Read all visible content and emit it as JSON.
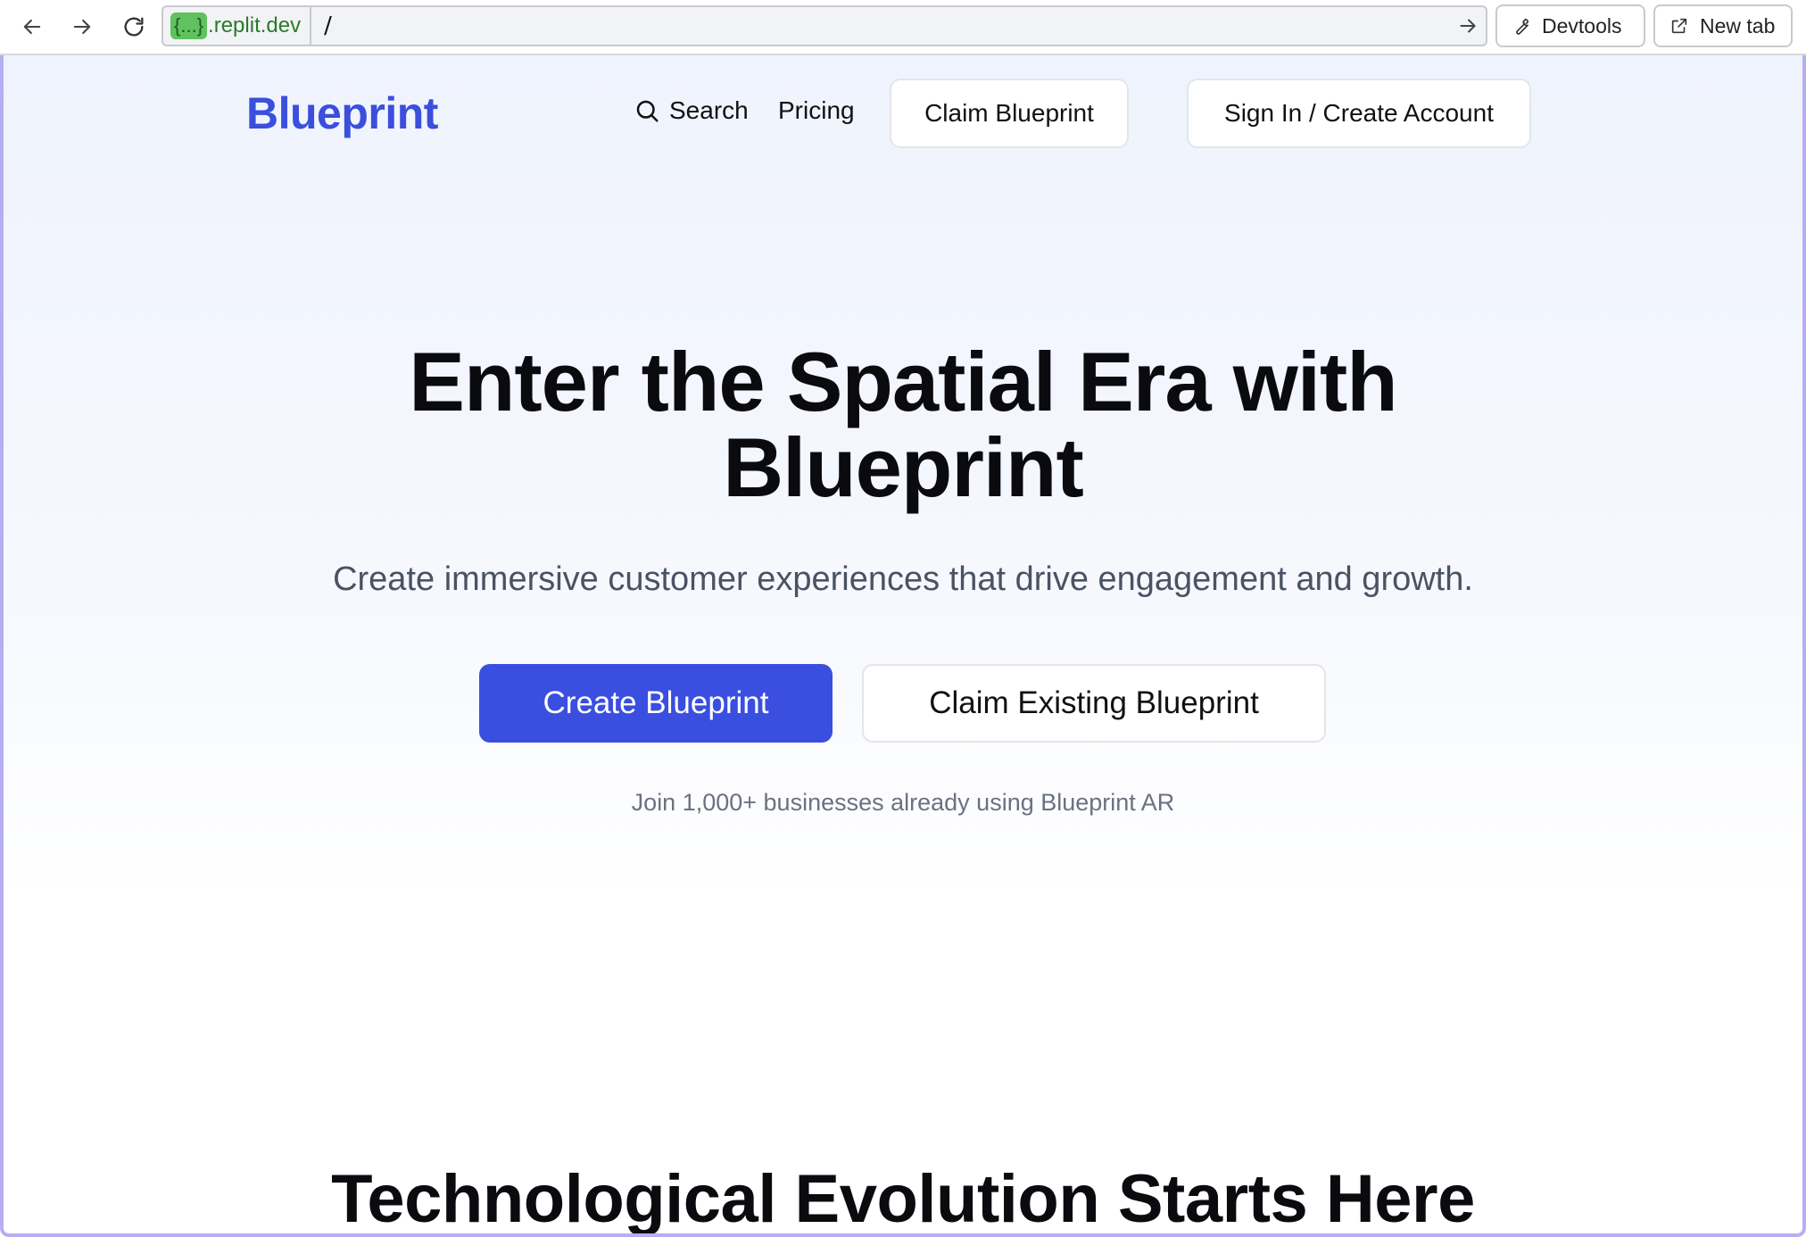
{
  "browser": {
    "url_host_pill": "{...}",
    "url_host": ".replit.dev",
    "url_path": "/",
    "devtools_label": "Devtools",
    "new_tab_label": "New tab"
  },
  "header": {
    "logo": "Blueprint",
    "search_label": "Search",
    "pricing_label": "Pricing",
    "claim_label": "Claim Blueprint",
    "signin_label": "Sign In / Create Account"
  },
  "hero": {
    "title_line1": "Enter the Spatial Era with",
    "title_line2": "Blueprint",
    "subtitle": "Create immersive customer experiences that drive engagement and growth.",
    "primary_cta": "Create Blueprint",
    "secondary_cta": "Claim Existing Blueprint",
    "social_proof": "Join 1,000+ businesses already using Blueprint AR"
  },
  "section": {
    "title": "Technological Evolution Starts Here"
  },
  "colors": {
    "brand": "#3a4fdc",
    "primary_button": "#3a4fe0",
    "viewport_border": "#b7aef2"
  },
  "icons": [
    "back-arrow-icon",
    "forward-arrow-icon",
    "reload-icon",
    "go-arrow-icon",
    "wrench-icon",
    "external-link-icon",
    "search-icon"
  ]
}
